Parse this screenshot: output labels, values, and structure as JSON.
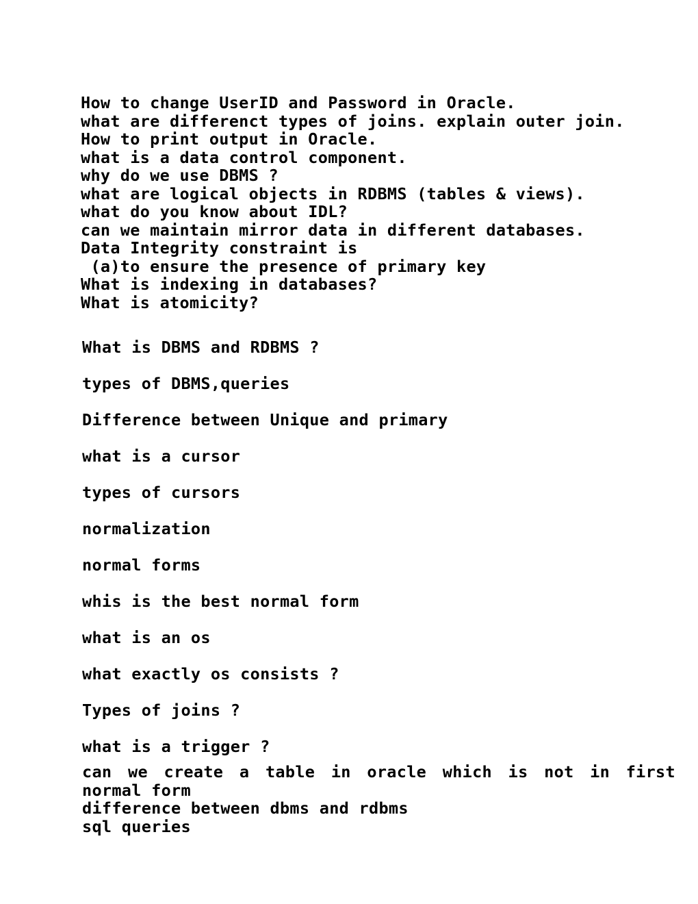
{
  "document": {
    "background_color": "#ffffff",
    "text_color": "#000000",
    "blocks": {
      "compact_top": {
        "lines": [
          "How to change UserID and Password in Oracle.",
          "what are differenct types of joins. explain outer join.",
          "How to print output in Oracle.",
          "what is a data control component.",
          "why do we use DBMS ?",
          "what are logical objects in RDBMS (tables & views).",
          "what do you know about IDL?",
          "can we maintain mirror data in different databases.",
          "Data Integrity constraint is",
          " (a)to ensure the presence of primary key",
          "What is indexing in databases?",
          "What is atomicity?"
        ]
      },
      "spaced": {
        "lines": [
          "What is DBMS and RDBMS ?",
          "types of DBMS,queries",
          "Difference between Unique and primary",
          "what is a cursor",
          "types of cursors",
          "normalization",
          "normal forms",
          "whis is the best normal form",
          "what is an os",
          "what exactly os consists ?",
          "Types of joins ?",
          "what is a trigger ?"
        ]
      },
      "compact_bottom": {
        "lines": [
          "can we create a table in oracle which is not in first",
          "normal form",
          "difference between dbms and rdbms",
          "sql queries"
        ]
      }
    }
  }
}
